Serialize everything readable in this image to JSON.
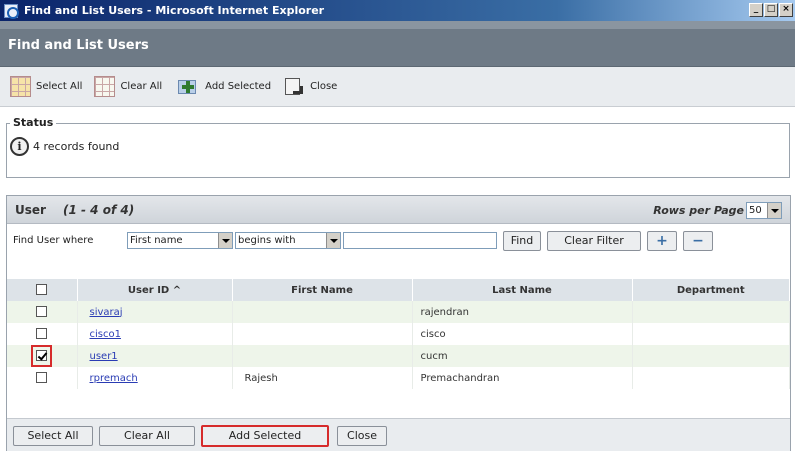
{
  "window": {
    "title": "Find and List Users - Microsoft Internet Explorer"
  },
  "header": {
    "title": "Find and List Users"
  },
  "toolbar": {
    "select_all": "Select All",
    "clear_all": "Clear All",
    "add_selected": "Add Selected",
    "close": "Close"
  },
  "status": {
    "legend": "Status",
    "message": "4 records found"
  },
  "users_panel": {
    "title": "User",
    "range": "(1 - 4 of 4)",
    "rows_per_page_label": "Rows per Page",
    "rows_per_page_value": "50"
  },
  "find": {
    "label": "Find User where",
    "field_value": "First name",
    "operator_value": "begins with",
    "search_value": "",
    "find_button": "Find",
    "clear_filter_button": "Clear Filter"
  },
  "table": {
    "columns": [
      "User ID ^",
      "First Name",
      "Last Name",
      "Department"
    ],
    "rows": [
      {
        "user_id": "sivaraj",
        "first_name": "",
        "last_name": "rajendran",
        "department": "",
        "checked": false
      },
      {
        "user_id": "cisco1",
        "first_name": "",
        "last_name": "cisco",
        "department": "",
        "checked": false
      },
      {
        "user_id": "user1",
        "first_name": "",
        "last_name": "cucm",
        "department": "",
        "checked": true
      },
      {
        "user_id": "rpremach",
        "first_name": "Rajesh",
        "last_name": "Premachandran",
        "department": "",
        "checked": false
      }
    ]
  },
  "footer": {
    "select_all": "Select All",
    "clear_all": "Clear All",
    "add_selected": "Add Selected",
    "close": "Close"
  },
  "colors": {
    "title_bar": "#0a246a",
    "header_bg": "#6e7a86",
    "row_alt": "#eef5ea",
    "highlight": "#d62b2b",
    "link": "#2a3cb4"
  }
}
